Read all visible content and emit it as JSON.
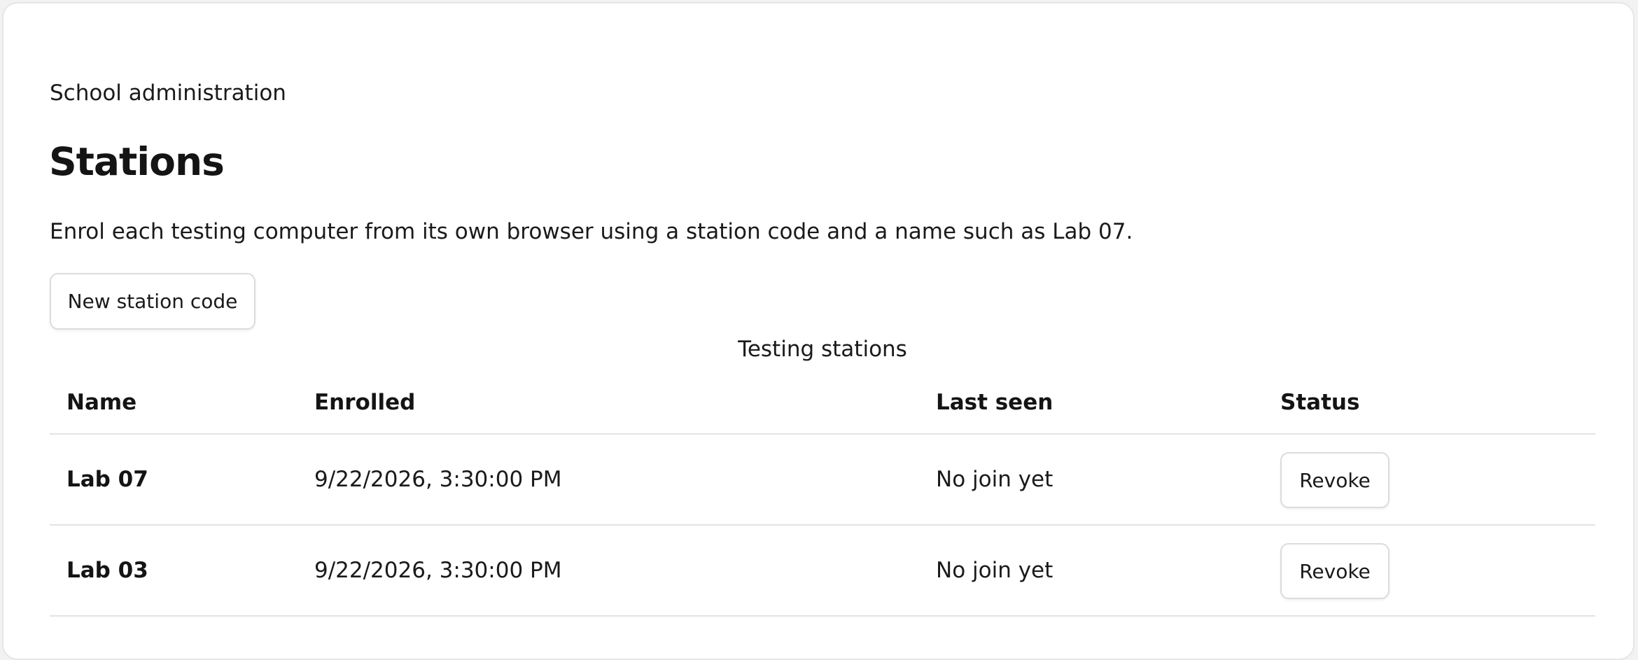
{
  "header": {
    "eyebrow": "School administration",
    "title": "Stations",
    "intro": "Enrol each testing computer from its own browser using a station code and a name such as Lab 07."
  },
  "actions": {
    "new_code_label": "New station code"
  },
  "table": {
    "caption": "Testing stations",
    "columns": [
      "Name",
      "Enrolled",
      "Last seen",
      "Status"
    ],
    "rows": [
      {
        "name": "Lab 07",
        "enrolled": "9/22/2026, 3:30:00 PM",
        "last_seen": "No join yet",
        "action": "Revoke"
      },
      {
        "name": "Lab 03",
        "enrolled": "9/22/2026, 3:30:00 PM",
        "last_seen": "No join yet",
        "action": "Revoke"
      }
    ]
  }
}
